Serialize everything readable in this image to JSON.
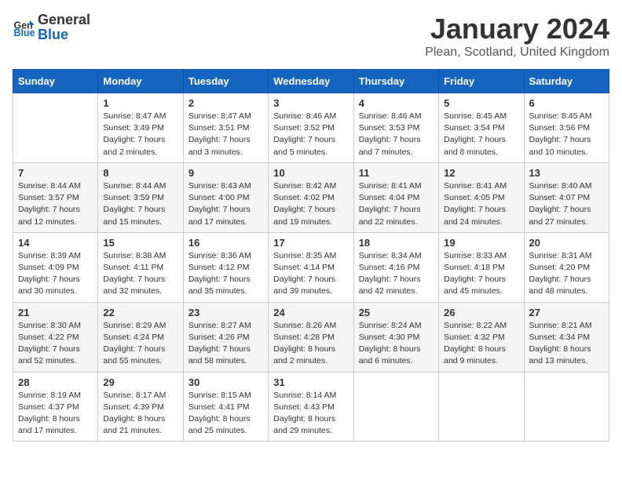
{
  "header": {
    "logo_general": "General",
    "logo_blue": "Blue",
    "month_year": "January 2024",
    "location": "Plean, Scotland, United Kingdom"
  },
  "weekdays": [
    "Sunday",
    "Monday",
    "Tuesday",
    "Wednesday",
    "Thursday",
    "Friday",
    "Saturday"
  ],
  "weeks": [
    [
      {
        "day": "",
        "sunrise": "",
        "sunset": "",
        "daylight": ""
      },
      {
        "day": "1",
        "sunrise": "Sunrise: 8:47 AM",
        "sunset": "Sunset: 3:49 PM",
        "daylight": "Daylight: 7 hours and 2 minutes."
      },
      {
        "day": "2",
        "sunrise": "Sunrise: 8:47 AM",
        "sunset": "Sunset: 3:51 PM",
        "daylight": "Daylight: 7 hours and 3 minutes."
      },
      {
        "day": "3",
        "sunrise": "Sunrise: 8:46 AM",
        "sunset": "Sunset: 3:52 PM",
        "daylight": "Daylight: 7 hours and 5 minutes."
      },
      {
        "day": "4",
        "sunrise": "Sunrise: 8:46 AM",
        "sunset": "Sunset: 3:53 PM",
        "daylight": "Daylight: 7 hours and 7 minutes."
      },
      {
        "day": "5",
        "sunrise": "Sunrise: 8:45 AM",
        "sunset": "Sunset: 3:54 PM",
        "daylight": "Daylight: 7 hours and 8 minutes."
      },
      {
        "day": "6",
        "sunrise": "Sunrise: 8:45 AM",
        "sunset": "Sunset: 3:56 PM",
        "daylight": "Daylight: 7 hours and 10 minutes."
      }
    ],
    [
      {
        "day": "7",
        "sunrise": "Sunrise: 8:44 AM",
        "sunset": "Sunset: 3:57 PM",
        "daylight": "Daylight: 7 hours and 12 minutes."
      },
      {
        "day": "8",
        "sunrise": "Sunrise: 8:44 AM",
        "sunset": "Sunset: 3:59 PM",
        "daylight": "Daylight: 7 hours and 15 minutes."
      },
      {
        "day": "9",
        "sunrise": "Sunrise: 8:43 AM",
        "sunset": "Sunset: 4:00 PM",
        "daylight": "Daylight: 7 hours and 17 minutes."
      },
      {
        "day": "10",
        "sunrise": "Sunrise: 8:42 AM",
        "sunset": "Sunset: 4:02 PM",
        "daylight": "Daylight: 7 hours and 19 minutes."
      },
      {
        "day": "11",
        "sunrise": "Sunrise: 8:41 AM",
        "sunset": "Sunset: 4:04 PM",
        "daylight": "Daylight: 7 hours and 22 minutes."
      },
      {
        "day": "12",
        "sunrise": "Sunrise: 8:41 AM",
        "sunset": "Sunset: 4:05 PM",
        "daylight": "Daylight: 7 hours and 24 minutes."
      },
      {
        "day": "13",
        "sunrise": "Sunrise: 8:40 AM",
        "sunset": "Sunset: 4:07 PM",
        "daylight": "Daylight: 7 hours and 27 minutes."
      }
    ],
    [
      {
        "day": "14",
        "sunrise": "Sunrise: 8:39 AM",
        "sunset": "Sunset: 4:09 PM",
        "daylight": "Daylight: 7 hours and 30 minutes."
      },
      {
        "day": "15",
        "sunrise": "Sunrise: 8:38 AM",
        "sunset": "Sunset: 4:11 PM",
        "daylight": "Daylight: 7 hours and 32 minutes."
      },
      {
        "day": "16",
        "sunrise": "Sunrise: 8:36 AM",
        "sunset": "Sunset: 4:12 PM",
        "daylight": "Daylight: 7 hours and 35 minutes."
      },
      {
        "day": "17",
        "sunrise": "Sunrise: 8:35 AM",
        "sunset": "Sunset: 4:14 PM",
        "daylight": "Daylight: 7 hours and 39 minutes."
      },
      {
        "day": "18",
        "sunrise": "Sunrise: 8:34 AM",
        "sunset": "Sunset: 4:16 PM",
        "daylight": "Daylight: 7 hours and 42 minutes."
      },
      {
        "day": "19",
        "sunrise": "Sunrise: 8:33 AM",
        "sunset": "Sunset: 4:18 PM",
        "daylight": "Daylight: 7 hours and 45 minutes."
      },
      {
        "day": "20",
        "sunrise": "Sunrise: 8:31 AM",
        "sunset": "Sunset: 4:20 PM",
        "daylight": "Daylight: 7 hours and 48 minutes."
      }
    ],
    [
      {
        "day": "21",
        "sunrise": "Sunrise: 8:30 AM",
        "sunset": "Sunset: 4:22 PM",
        "daylight": "Daylight: 7 hours and 52 minutes."
      },
      {
        "day": "22",
        "sunrise": "Sunrise: 8:29 AM",
        "sunset": "Sunset: 4:24 PM",
        "daylight": "Daylight: 7 hours and 55 minutes."
      },
      {
        "day": "23",
        "sunrise": "Sunrise: 8:27 AM",
        "sunset": "Sunset: 4:26 PM",
        "daylight": "Daylight: 7 hours and 58 minutes."
      },
      {
        "day": "24",
        "sunrise": "Sunrise: 8:26 AM",
        "sunset": "Sunset: 4:28 PM",
        "daylight": "Daylight: 8 hours and 2 minutes."
      },
      {
        "day": "25",
        "sunrise": "Sunrise: 8:24 AM",
        "sunset": "Sunset: 4:30 PM",
        "daylight": "Daylight: 8 hours and 6 minutes."
      },
      {
        "day": "26",
        "sunrise": "Sunrise: 8:22 AM",
        "sunset": "Sunset: 4:32 PM",
        "daylight": "Daylight: 8 hours and 9 minutes."
      },
      {
        "day": "27",
        "sunrise": "Sunrise: 8:21 AM",
        "sunset": "Sunset: 4:34 PM",
        "daylight": "Daylight: 8 hours and 13 minutes."
      }
    ],
    [
      {
        "day": "28",
        "sunrise": "Sunrise: 8:19 AM",
        "sunset": "Sunset: 4:37 PM",
        "daylight": "Daylight: 8 hours and 17 minutes."
      },
      {
        "day": "29",
        "sunrise": "Sunrise: 8:17 AM",
        "sunset": "Sunset: 4:39 PM",
        "daylight": "Daylight: 8 hours and 21 minutes."
      },
      {
        "day": "30",
        "sunrise": "Sunrise: 8:15 AM",
        "sunset": "Sunset: 4:41 PM",
        "daylight": "Daylight: 8 hours and 25 minutes."
      },
      {
        "day": "31",
        "sunrise": "Sunrise: 8:14 AM",
        "sunset": "Sunset: 4:43 PM",
        "daylight": "Daylight: 8 hours and 29 minutes."
      },
      {
        "day": "",
        "sunrise": "",
        "sunset": "",
        "daylight": ""
      },
      {
        "day": "",
        "sunrise": "",
        "sunset": "",
        "daylight": ""
      },
      {
        "day": "",
        "sunrise": "",
        "sunset": "",
        "daylight": ""
      }
    ]
  ]
}
